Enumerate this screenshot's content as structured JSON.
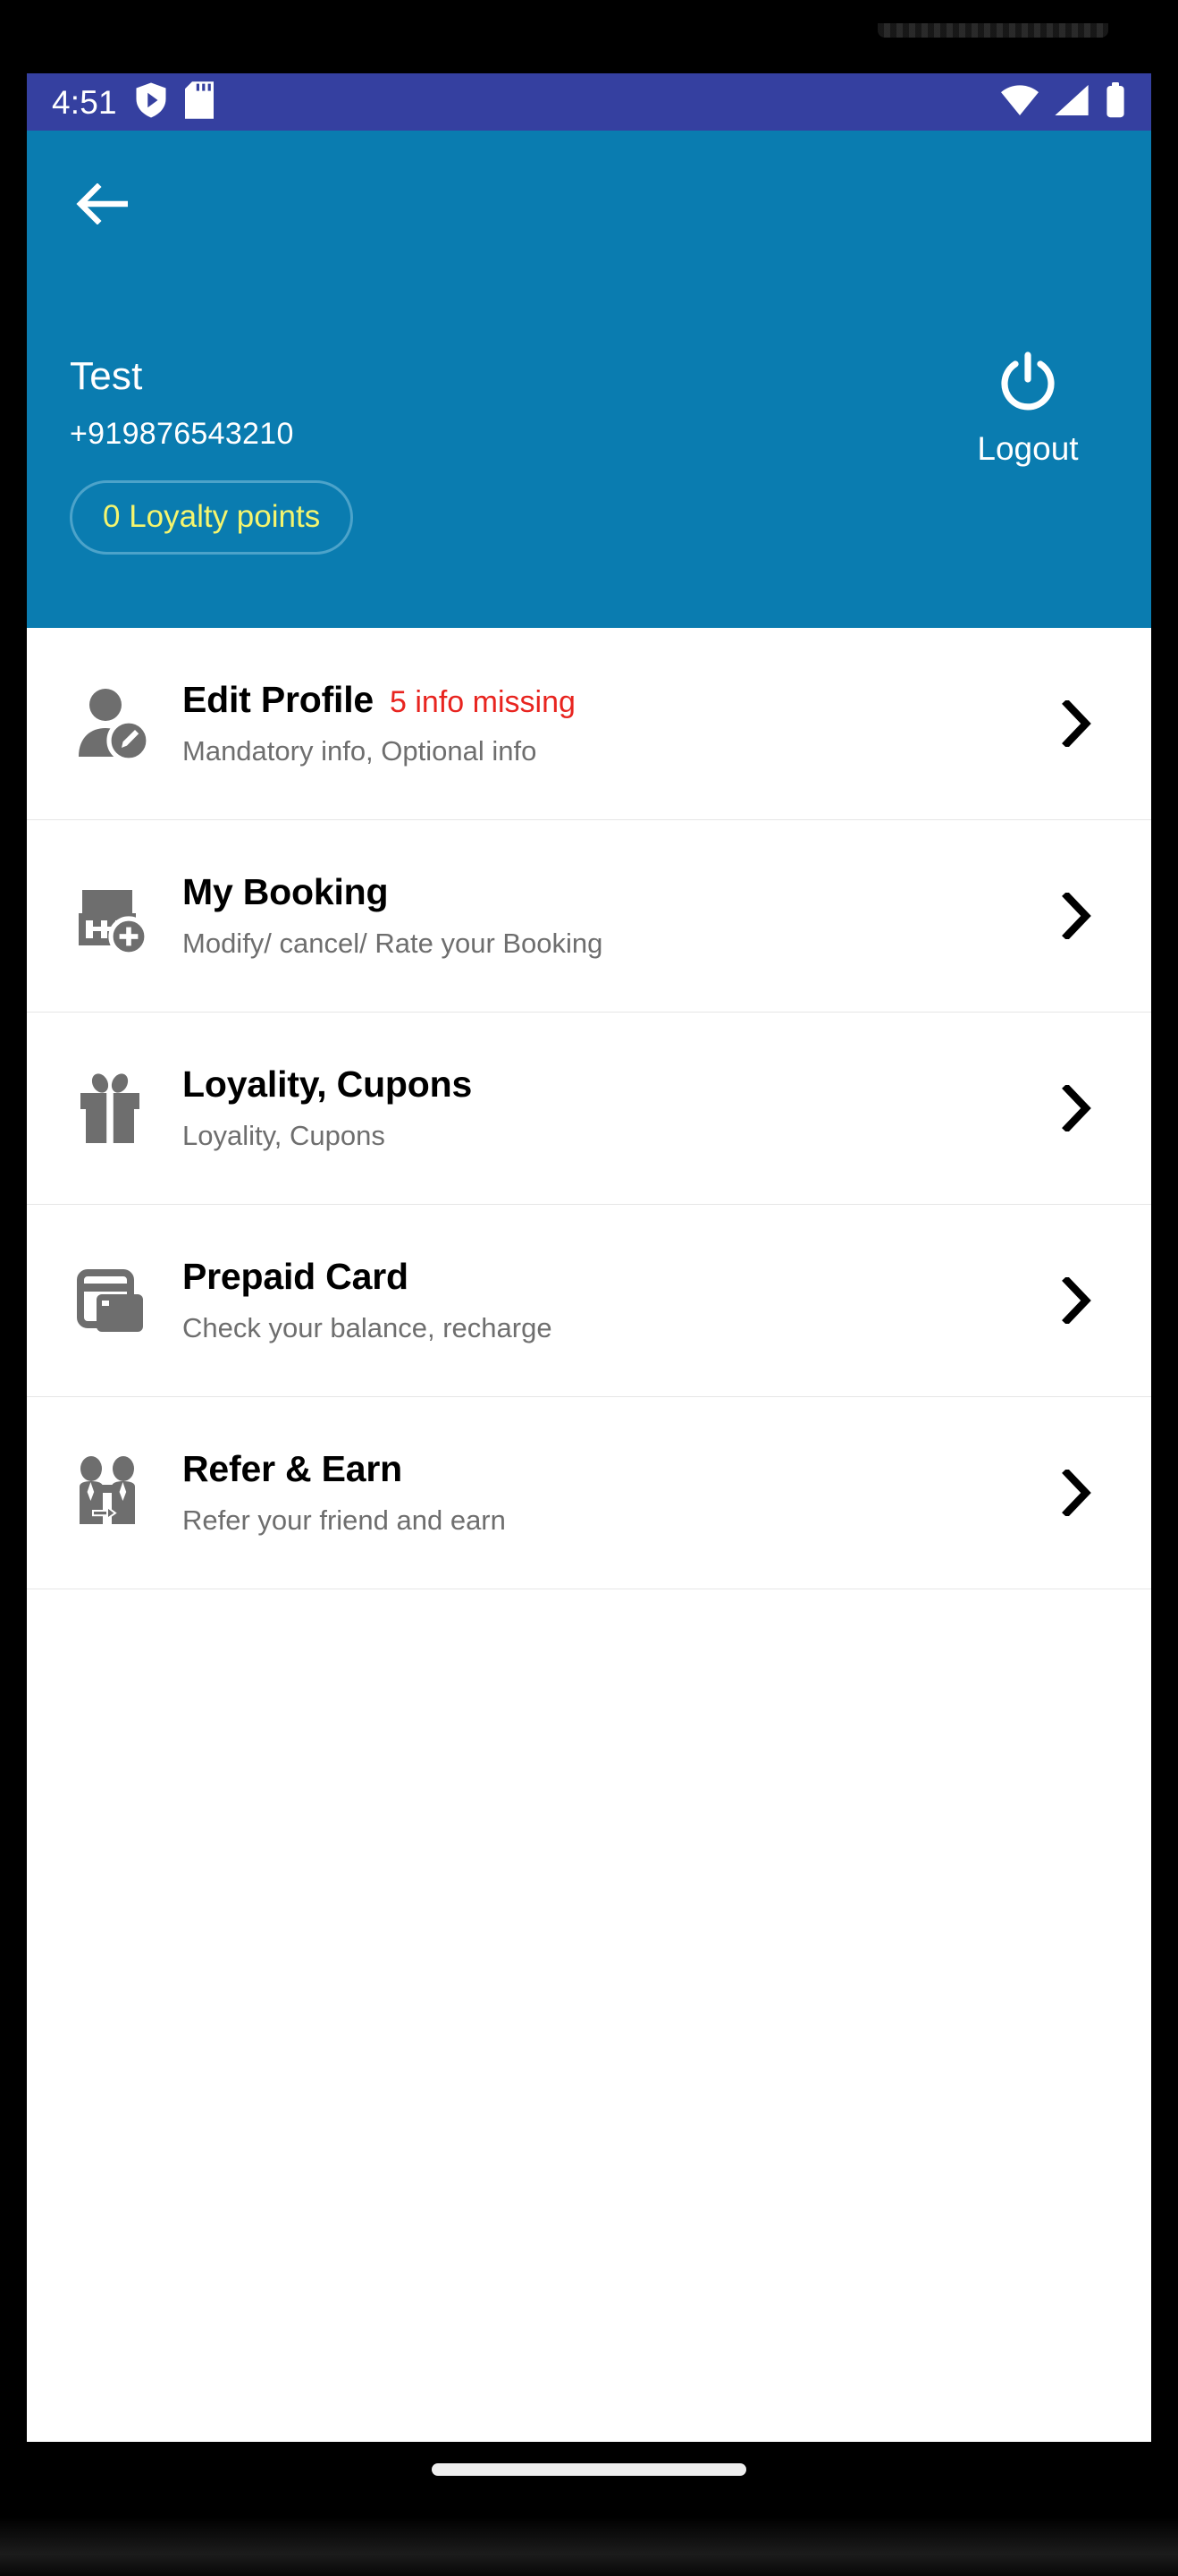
{
  "status_bar": {
    "time": "4:51",
    "left_icons": [
      "shield-play-icon",
      "sd-card-icon"
    ],
    "right_icons": [
      "wifi-icon",
      "cellular-signal-icon",
      "battery-icon"
    ],
    "background_color": "#3540a0"
  },
  "header": {
    "back_icon": "back-arrow-icon",
    "user_name": "Test",
    "user_phone": "+919876543210",
    "loyalty_chip_label": "0 Loyalty points",
    "loyalty_chip_text_color": "#f5f56e",
    "logout_label": "Logout",
    "logout_icon": "power-icon",
    "background_color": "#0a7cb0"
  },
  "menu": {
    "items": [
      {
        "icon": "edit-profile-icon",
        "title": "Edit Profile",
        "badge": "5 info missing",
        "badge_color": "#e8241f",
        "subtitle": "Mandatory info, Optional info",
        "chevron": "chevron-right-icon"
      },
      {
        "icon": "calendar-booking-icon",
        "title": "My Booking",
        "badge": "",
        "badge_color": "#e8241f",
        "subtitle": "Modify/ cancel/ Rate your Booking",
        "chevron": "chevron-right-icon"
      },
      {
        "icon": "gift-icon",
        "title": "Loyality, Cupons",
        "badge": "",
        "badge_color": "#e8241f",
        "subtitle": "Loyality, Cupons",
        "chevron": "chevron-right-icon"
      },
      {
        "icon": "credit-card-icon",
        "title": "Prepaid Card",
        "badge": "",
        "badge_color": "#e8241f",
        "subtitle": "Check your balance, recharge",
        "chevron": "chevron-right-icon"
      },
      {
        "icon": "refer-friend-icon",
        "title": "Refer & Earn",
        "badge": "",
        "badge_color": "#e8241f",
        "subtitle": "Refer your friend and earn",
        "chevron": "chevron-right-icon"
      }
    ]
  },
  "navigation": {
    "home_indicator": "home-indicator"
  }
}
